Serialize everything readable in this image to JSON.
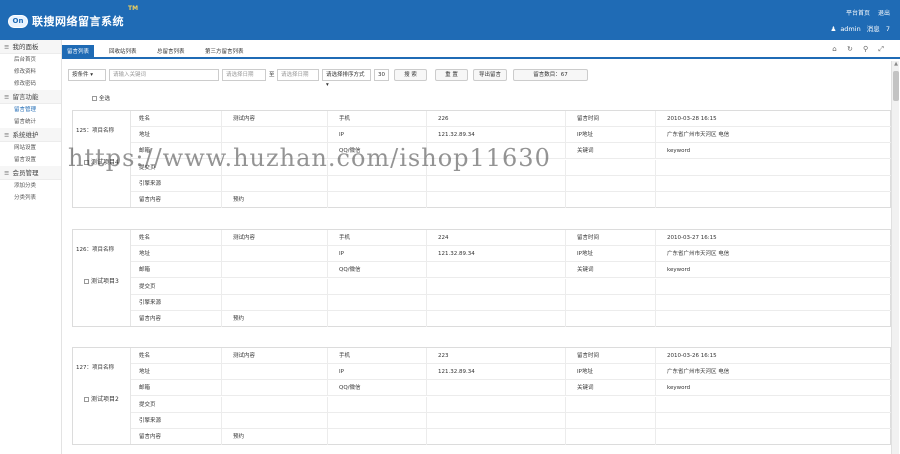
{
  "header": {
    "logo_badge": "On",
    "logo_text": "联搜网络留言系统",
    "tm": "TM",
    "links": [
      "平台首页",
      "退出"
    ],
    "user_label": "admin",
    "msg_label": "消息",
    "msg_count": "7"
  },
  "sidebar": {
    "groups": [
      {
        "label": "我的面板",
        "items": [
          "后台首页",
          "修改资料",
          "修改密码"
        ]
      },
      {
        "label": "留言功能",
        "items": [
          "留言管理",
          "留言统计"
        ]
      },
      {
        "label": "系统维护",
        "items": [
          "网站设置",
          "留言设置"
        ]
      },
      {
        "label": "会员管理",
        "items": [
          "添加分类",
          "分类列表"
        ]
      }
    ]
  },
  "tabs": [
    "留言列表",
    "回收站列表",
    "总留言列表",
    "第三方留言列表"
  ],
  "tab_icons": "⌂ ↻ ⚲ ⤢",
  "filter": {
    "condition": "按条件",
    "keyword_placeholder": "请输入关键词",
    "start_placeholder": "请选择日期",
    "to": "至",
    "end_placeholder": "请选择日期",
    "sort": "请选择排序方式",
    "page_size": "30",
    "search_btn": "搜 索",
    "reset_btn": "重 置",
    "export_btn": "导出留言",
    "count_btn": "留言数目：67"
  },
  "select_all": "全选",
  "watermark": "https://www.huzhan.com/ishop11630",
  "records": [
    {
      "title": "125：项目名称",
      "check_label": "测试项目4",
      "rows": [
        [
          "姓名",
          "测试内容",
          "手机",
          "226",
          "留言时间",
          "2010-03-28 16:15"
        ],
        [
          "地址",
          "",
          "IP",
          "121.32.89.34",
          "IP地址",
          "广东省广州市天河区 电信"
        ],
        [
          "邮箱",
          "",
          "QQ/微信",
          "",
          "关键词",
          "keyword"
        ],
        [
          "提交页",
          "",
          "",
          "",
          "",
          ""
        ],
        [
          "引擎来源",
          "",
          "",
          "",
          "",
          ""
        ],
        [
          "留言内容",
          "预约",
          "",
          "",
          "",
          ""
        ]
      ]
    },
    {
      "title": "126：项目名称",
      "check_label": "测试项目3",
      "rows": [
        [
          "姓名",
          "测试内容",
          "手机",
          "224",
          "留言时间",
          "2010-03-27 16:15"
        ],
        [
          "地址",
          "",
          "IP",
          "121.32.89.34",
          "IP地址",
          "广东省广州市天河区 电信"
        ],
        [
          "邮箱",
          "",
          "QQ/微信",
          "",
          "关键词",
          "keyword"
        ],
        [
          "提交页",
          "",
          "",
          "",
          "",
          ""
        ],
        [
          "引擎来源",
          "",
          "",
          "",
          "",
          ""
        ],
        [
          "留言内容",
          "预约",
          "",
          "",
          "",
          ""
        ]
      ]
    },
    {
      "title": "127：项目名称",
      "check_label": "测试项目2",
      "rows": [
        [
          "姓名",
          "测试内容",
          "手机",
          "223",
          "留言时间",
          "2010-03-26 16:15"
        ],
        [
          "地址",
          "",
          "IP",
          "121.32.89.34",
          "IP地址",
          "广东省广州市天河区 电信"
        ],
        [
          "邮箱",
          "",
          "QQ/微信",
          "",
          "关键词",
          "keyword"
        ],
        [
          "提交页",
          "",
          "",
          "",
          "",
          ""
        ],
        [
          "引擎来源",
          "",
          "",
          "",
          "",
          ""
        ],
        [
          "留言内容",
          "预约",
          "",
          "",
          "",
          ""
        ]
      ]
    }
  ]
}
